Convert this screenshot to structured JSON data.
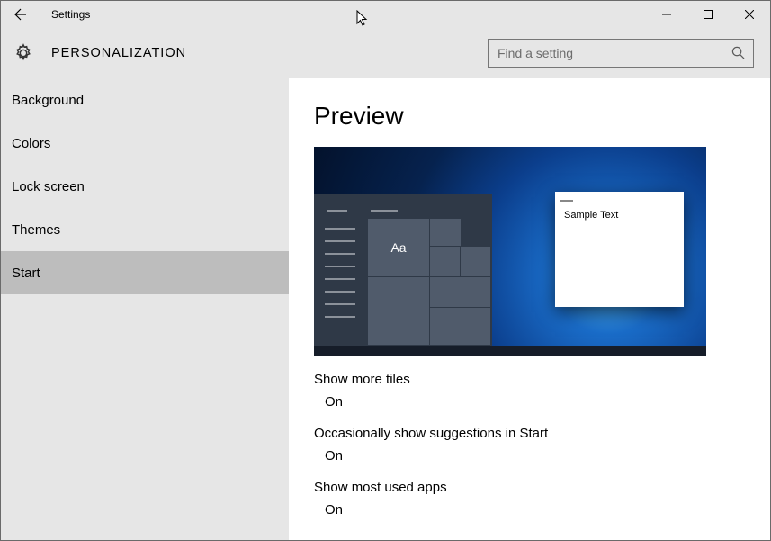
{
  "window": {
    "title": "Settings"
  },
  "header": {
    "category": "PERSONALIZATION",
    "search_placeholder": "Find a setting"
  },
  "sidebar": {
    "items": [
      {
        "label": "Background",
        "selected": false
      },
      {
        "label": "Colors",
        "selected": false
      },
      {
        "label": "Lock screen",
        "selected": false
      },
      {
        "label": "Themes",
        "selected": false
      },
      {
        "label": "Start",
        "selected": true
      }
    ]
  },
  "content": {
    "heading": "Preview",
    "sample_text": "Sample Text",
    "tile_text": "Aa",
    "settings": [
      {
        "label": "Show more tiles",
        "value": true,
        "state_text": "On"
      },
      {
        "label": "Occasionally show suggestions in Start",
        "value": true,
        "state_text": "On"
      },
      {
        "label": "Show most used apps",
        "value": true,
        "state_text": "On"
      }
    ]
  }
}
